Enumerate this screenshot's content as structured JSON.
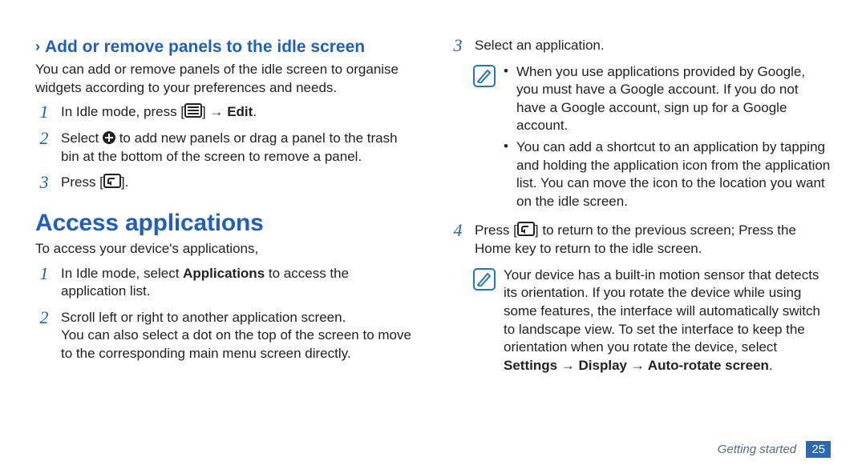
{
  "left": {
    "subhead": "Add or remove panels to the idle screen",
    "intro": "You can add or remove panels of the idle screen to organise widgets according to your preferences and needs.",
    "steps": [
      {
        "pre": "In Idle mode, press [",
        "icon": "menu",
        "post": "] → ",
        "bold": "Edit",
        "tail": "."
      },
      {
        "pre": "Select ",
        "icon": "plus",
        "post": " to add new panels or drag a panel to the trash bin at the bottom of the screen to remove a panel."
      },
      {
        "pre": "Press [",
        "icon": "back",
        "post": "]."
      }
    ],
    "h1": "Access applications",
    "access_intro": "To access your device's applications,",
    "access_steps": [
      {
        "t1": "In Idle mode, select ",
        "b": "Applications",
        "t2": " to access the application list."
      },
      {
        "t": "Scroll left or right to another application screen.\nYou can also select a dot on the top of the screen to move to the corresponding main menu screen directly."
      }
    ]
  },
  "right": {
    "step3": "Select an application.",
    "note1": {
      "b1": "When you use applications provided by Google, you must have a Google account. If you do not have a Google account, sign up for a Google account.",
      "b2": "You can add a shortcut to an application by tapping and holding the application icon from the application list. You can move the icon to the location you want on the idle screen."
    },
    "step4_pre": "Press [",
    "step4_post": "] to return to the previous screen; Press the Home key to return to the idle screen.",
    "note2_pre": "Your device has a built-in motion sensor that detects its orientation. If you rotate the device while using some features, the interface will automatically switch to landscape view. To set the interface to keep the orientation when you rotate the device, select ",
    "note2_bold": "Settings → Display → Auto-rotate screen",
    "note2_tail": "."
  },
  "footer": {
    "section": "Getting started",
    "page": "25"
  }
}
